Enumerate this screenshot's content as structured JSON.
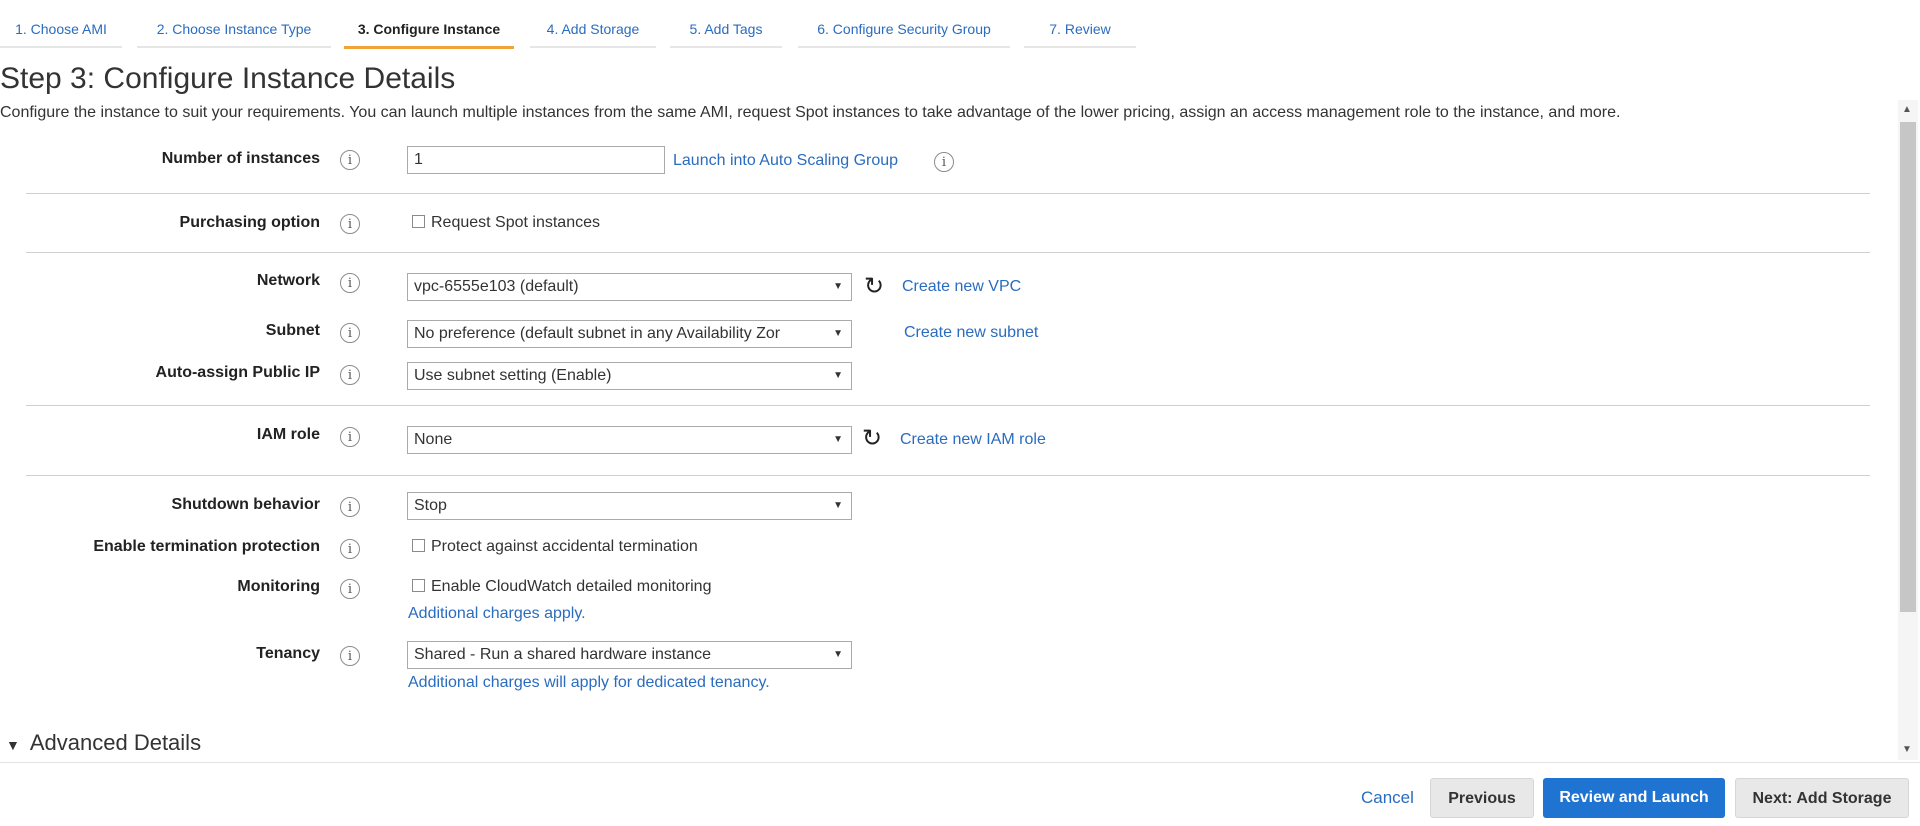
{
  "tabs": [
    {
      "label": "1. Choose AMI"
    },
    {
      "label": "2. Choose Instance Type"
    },
    {
      "label": "3. Configure Instance"
    },
    {
      "label": "4. Add Storage"
    },
    {
      "label": "5. Add Tags"
    },
    {
      "label": "6. Configure Security Group"
    },
    {
      "label": "7. Review"
    }
  ],
  "header": {
    "title": "Step 3: Configure Instance Details",
    "description": "Configure the instance to suit your requirements. You can launch multiple instances from the same AMI, request Spot instances to take advantage of the lower pricing, assign an access management role to the instance, and more."
  },
  "form": {
    "info_icon": "i",
    "number_of_instances": {
      "label": "Number of instances",
      "value": "1",
      "link": "Launch into Auto Scaling Group"
    },
    "purchasing_option": {
      "label": "Purchasing option",
      "checkbox_label": "Request Spot instances",
      "checked": false
    },
    "network": {
      "label": "Network",
      "value": "vpc-6555e103 (default)",
      "link": "Create new VPC"
    },
    "subnet": {
      "label": "Subnet",
      "value": "No preference (default subnet in any Availability Zor",
      "link": "Create new subnet"
    },
    "auto_assign_ip": {
      "label": "Auto-assign Public IP",
      "value": "Use subnet setting (Enable)"
    },
    "iam_role": {
      "label": "IAM role",
      "value": "None",
      "link": "Create new IAM role"
    },
    "shutdown_behavior": {
      "label": "Shutdown behavior",
      "value": "Stop"
    },
    "termination_protection": {
      "label": "Enable termination protection",
      "checkbox_label": "Protect against accidental termination",
      "checked": false
    },
    "monitoring": {
      "label": "Monitoring",
      "checkbox_label": "Enable CloudWatch detailed monitoring",
      "checked": false,
      "note": "Additional charges apply."
    },
    "tenancy": {
      "label": "Tenancy",
      "value": "Shared - Run a shared hardware instance",
      "note": "Additional charges will apply for dedicated tenancy."
    }
  },
  "advanced": {
    "label": "Advanced Details"
  },
  "footer": {
    "cancel": "Cancel",
    "previous": "Previous",
    "review_launch": "Review and Launch",
    "next": "Next: Add Storage"
  },
  "icons": {
    "refresh": "↻",
    "caret": "▼",
    "triangle_down": "▼",
    "scroll_up": "▲",
    "scroll_down": "▼"
  },
  "colors": {
    "accent": "#f0a33b",
    "link": "#2a6cbf",
    "primary_button": "#1f74d1"
  }
}
